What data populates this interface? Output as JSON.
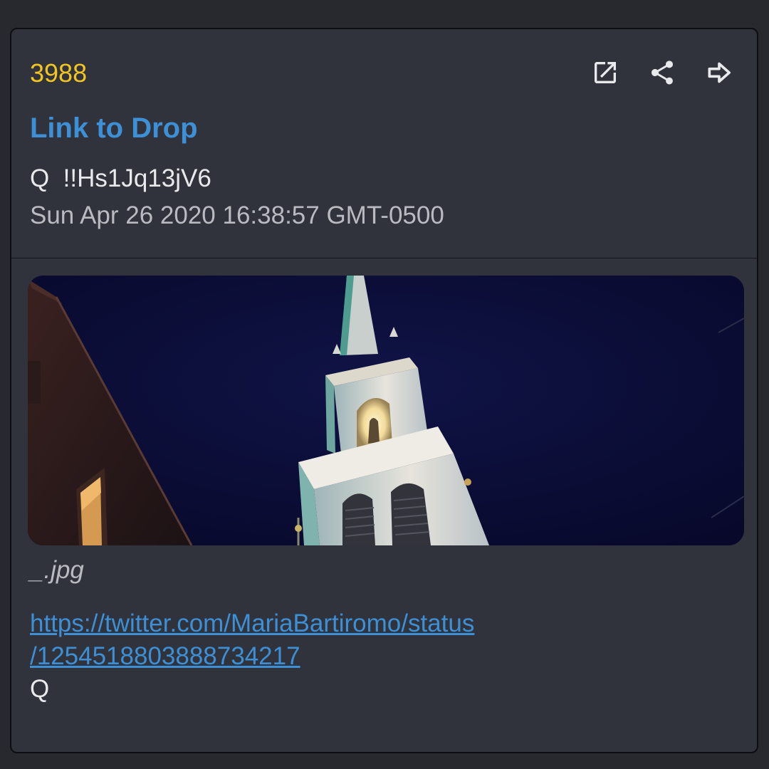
{
  "post": {
    "number": "3988",
    "link_label": "Link to Drop",
    "author_line": "Q  !!Hs1Jq13jV6",
    "timestamp": "Sun Apr 26 2020 16:38:57 GMT-0500",
    "image_filename": "_.jpg",
    "url_line1": "https://twitter.com/MariaBartiromo/status",
    "url_line2": "/1254518803888734217",
    "signature": "Q"
  },
  "actions": [
    {
      "name": "open-external",
      "icon": "open-in-new-icon"
    },
    {
      "name": "share",
      "icon": "share-icon"
    },
    {
      "name": "forward",
      "icon": "forward-arrow-icon"
    }
  ],
  "colors": {
    "background": "#27292f",
    "card": "#30333b",
    "post_number": "#f3c522",
    "link": "#3d8fd6",
    "text": "#e8e9ec",
    "muted_text": "#b9bbc0"
  }
}
